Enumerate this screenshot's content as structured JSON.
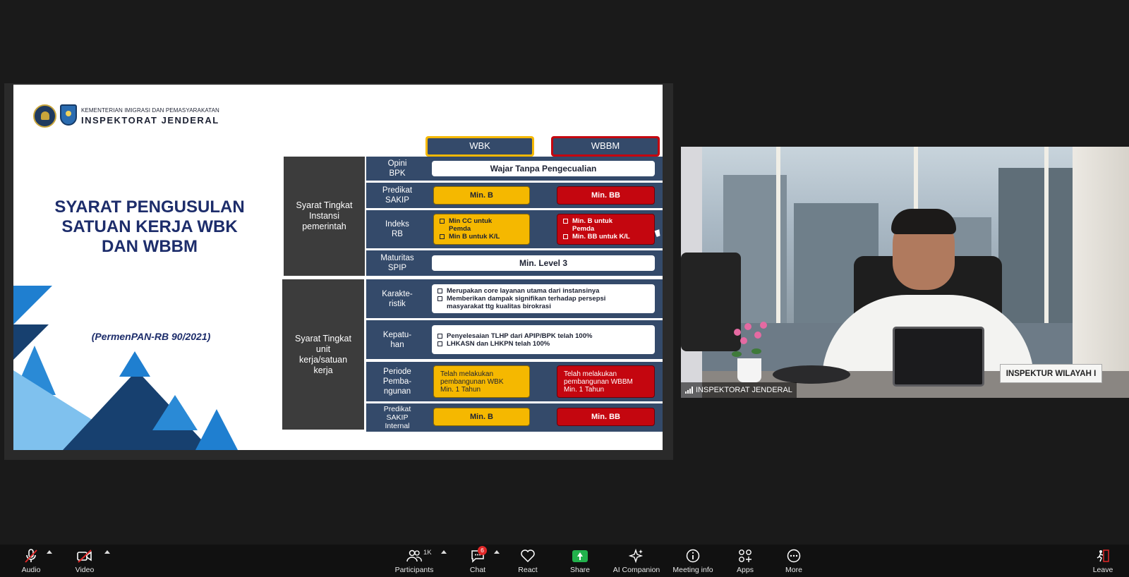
{
  "slide": {
    "ministry": "KEMENTERIAN IMIGRASI DAN PEMASYARAKATAN",
    "inspektorat": "INSPEKTORAT JENDERAL",
    "title": "SYARAT PENGUSULAN\nSATUAN KERJA WBK\nDAN WBBM",
    "regulation": "(PermenPAN-RB 90/2021)",
    "col_wbk": "WBK",
    "col_wbbm": "WBBM",
    "groups": [
      {
        "label": "Syarat Tingkat\nInstansi\npemerintah"
      },
      {
        "label": "Syarat Tingkat\nunit\nkerja/satuan\nkerja"
      }
    ],
    "rows": {
      "opini": {
        "label": "Opini\nBPK",
        "value": "Wajar Tanpa Pengecualian"
      },
      "sakip": {
        "label": "Predikat\nSAKIP",
        "wbk": "Min. B",
        "wbbm": "Min. BB"
      },
      "indeks": {
        "label": "Indeks\nRB",
        "wbk": [
          "Min CC untuk\nPemda",
          "Min B untuk K/L"
        ],
        "wbbm": [
          "Min. B untuk\nPemda",
          "Min. BB untuk K/L"
        ]
      },
      "maturitas": {
        "label": "Maturitas\nSPIP",
        "value": "Min. Level 3"
      },
      "karakter": {
        "label": "Karakte-\nristik",
        "items": [
          "Merupakan core layanan utama dari instansinya",
          "Memberikan dampak signifikan terhadap persepsi\nmasyarakat ttg kualitas birokrasi"
        ]
      },
      "kepatuhan": {
        "label": "Kepatu-\nhan",
        "items": [
          "Penyelesaian TLHP dari APIP/BPK telah 100%",
          "LHKASN  dan LHKPN telah 100%"
        ]
      },
      "periode": {
        "label": "Periode\nPemba-\nngunan",
        "wbk": "Telah melakukan\npembangunan WBK\nMin. 1 Tahun",
        "wbbm": "Telah melakukan\npembangunan WBBM\nMin. 1 Tahun"
      },
      "sakip_internal": {
        "label": "Predikat\nSAKIP\nInternal",
        "wbk": "Min. B",
        "wbbm": "Min. BB"
      }
    }
  },
  "video": {
    "nameplate": "INSPEKTUR WILAYAH I",
    "participant_name": "INSPEKTORAT JENDERAL"
  },
  "toolbar": {
    "audio": "Audio",
    "video": "Video",
    "participants": "Participants",
    "participants_count": "1K",
    "chat": "Chat",
    "chat_badge": "6",
    "react": "React",
    "share": "Share",
    "ai_companion": "AI Companion",
    "meeting_info": "Meeting info",
    "apps": "Apps",
    "more": "More",
    "leave": "Leave"
  },
  "colors": {
    "title_navy": "#1d2d6b",
    "row_bg": "#344a6a",
    "wbk_yellow": "#f5b800",
    "wbbm_red": "#c4060f",
    "share_green": "#22b14c",
    "badge_red": "#e02828"
  }
}
